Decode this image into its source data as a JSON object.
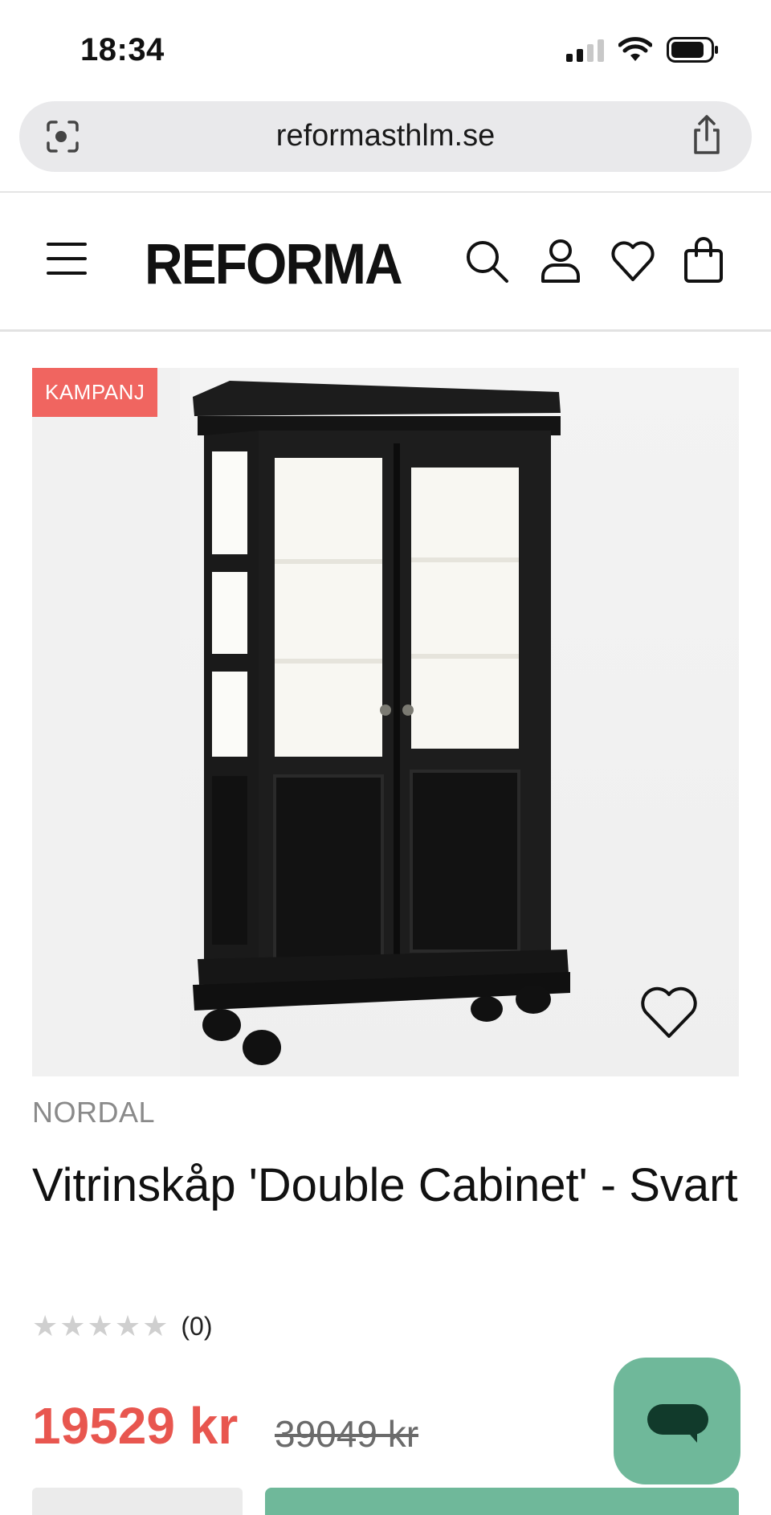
{
  "status_bar": {
    "time": "18:34"
  },
  "browser": {
    "url": "reformasthlm.se"
  },
  "header": {
    "logo": "REFORMA"
  },
  "product": {
    "badge": "KAMPANJ",
    "brand": "NORDAL",
    "title": "Vitrinskåp 'Double Cabinet' - Svart",
    "stars": "★★★★★",
    "rating_count": "(0)",
    "price": "19529 kr",
    "old_price": "39049 kr"
  },
  "colors": {
    "accent_green": "#6fb89a",
    "sale_red": "#e8564f",
    "badge_red": "#f06560"
  }
}
